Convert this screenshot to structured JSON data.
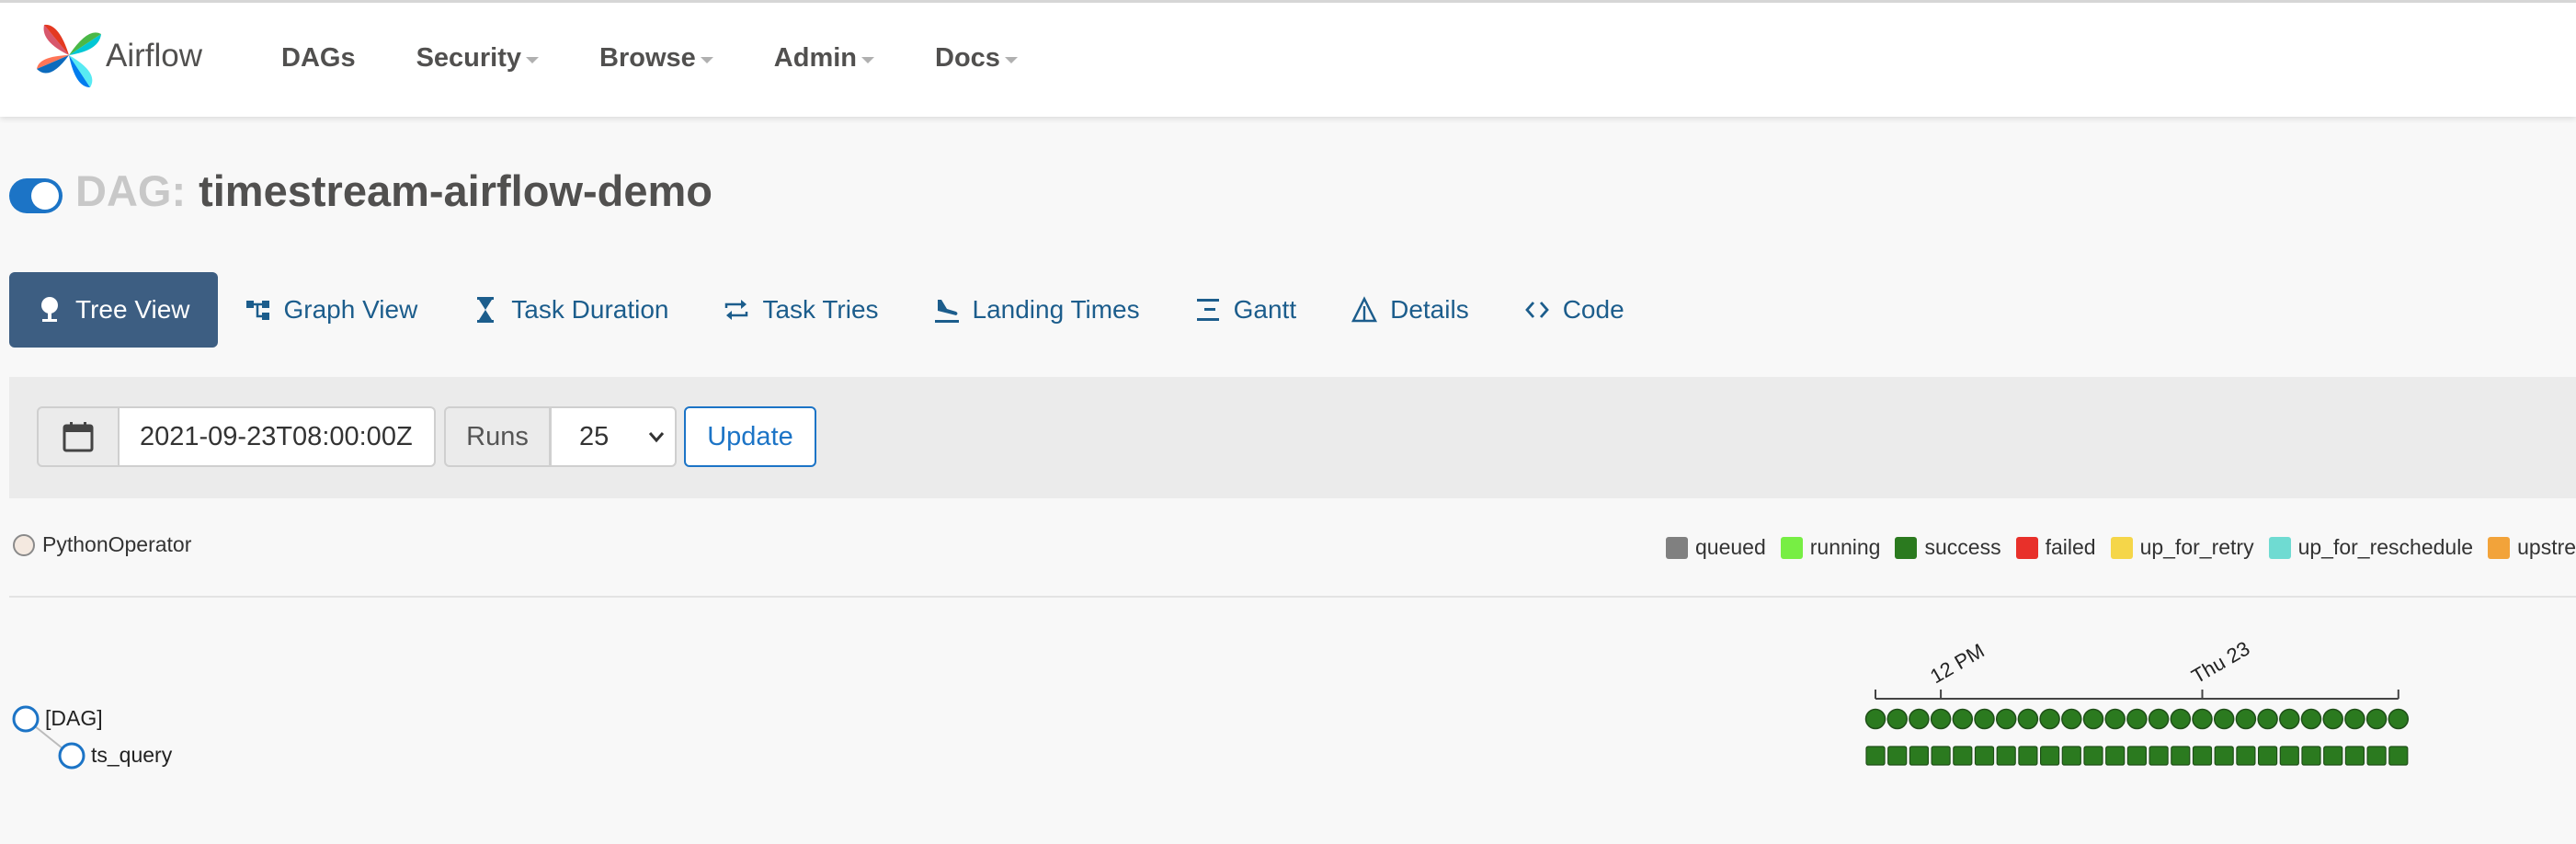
{
  "navbar": {
    "brand": "Airflow",
    "logo_icon": "airflow-pinwheel-icon",
    "menu": [
      {
        "label": "DAGs",
        "dropdown": false
      },
      {
        "label": "Security",
        "dropdown": true
      },
      {
        "label": "Browse",
        "dropdown": true
      },
      {
        "label": "Admin",
        "dropdown": true
      },
      {
        "label": "Docs",
        "dropdown": true
      }
    ]
  },
  "dag": {
    "label": "DAG:",
    "name": "timestream-airflow-demo",
    "paused": false
  },
  "tabs": [
    {
      "label": "Tree View",
      "icon": "tree-icon",
      "active": true
    },
    {
      "label": "Graph View",
      "icon": "graph-icon",
      "active": false
    },
    {
      "label": "Task Duration",
      "icon": "hourglass-icon",
      "active": false
    },
    {
      "label": "Task Tries",
      "icon": "retry-icon",
      "active": false
    },
    {
      "label": "Landing Times",
      "icon": "plane-landing-icon",
      "active": false
    },
    {
      "label": "Gantt",
      "icon": "gantt-icon",
      "active": false
    },
    {
      "label": "Details",
      "icon": "warning-triangle-icon",
      "active": false
    },
    {
      "label": "Code",
      "icon": "code-icon",
      "active": false
    }
  ],
  "filter": {
    "calendar_icon": "calendar-icon",
    "date_value": "2021-09-23T08:00:00Z",
    "runs_label": "Runs",
    "runs_value": "25",
    "update_label": "Update"
  },
  "operator": {
    "label": "PythonOperator",
    "color": "#f4e9e0"
  },
  "legend": [
    {
      "label": "queued",
      "color": "#808080"
    },
    {
      "label": "running",
      "color": "#77ee44"
    },
    {
      "label": "success",
      "color": "#2b7a1f"
    },
    {
      "label": "failed",
      "color": "#e8302a"
    },
    {
      "label": "up_for_retry",
      "color": "#f5d649"
    },
    {
      "label": "up_for_reschedule",
      "color": "#6fdbd2"
    },
    {
      "label": "upstream_",
      "color": "#f2a33a"
    }
  ],
  "tree": {
    "nodes": [
      {
        "label": "[DAG]"
      },
      {
        "label": "ts_query"
      }
    ],
    "time_axis": [
      "12 PM",
      "Thu 23"
    ],
    "run_count": 25,
    "run_state": "success",
    "colors": {
      "success": "#2b7a1f",
      "node_stroke": "#1c74c6"
    }
  },
  "colors": {
    "accent": "#1c74c6",
    "active_tab": "#3d5e82",
    "nav_text": "#51504f"
  }
}
